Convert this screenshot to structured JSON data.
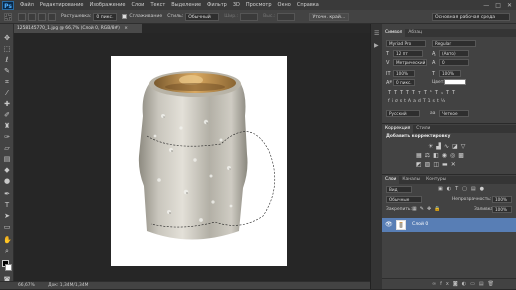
{
  "app": {
    "logo": "Ps"
  },
  "menu": [
    "Файл",
    "Редактирование",
    "Изображение",
    "Слои",
    "Текст",
    "Выделение",
    "Фильтр",
    "3D",
    "Просмотр",
    "Окно",
    "Справка"
  ],
  "window_controls": {
    "minimize": "—",
    "maximize": "□",
    "close": "✕"
  },
  "options": {
    "feather_label": "Растушевка:",
    "feather_value": "0 пикс.",
    "antialias_label": "Сглаживание",
    "style_label": "Стиль:",
    "style_value": "Обычный",
    "width_label": "Шир.:",
    "height_label": "Выс.:",
    "refine_button": "Уточн. край...",
    "workspace": "Основная рабочая среда"
  },
  "document": {
    "tab_title": "1258145770_1.jpg @ 66,7% (Слой 0, RGB/8#)",
    "tab_close": "×"
  },
  "status": {
    "zoom": "66,67%",
    "doc_size": "Док: 1,34М/1,34М"
  },
  "character_panel": {
    "tabs": [
      "Символ",
      "Абзац"
    ],
    "font_family": "Myriad Pro",
    "font_style": "Regular",
    "font_size": "12 пт",
    "leading": "(Авто)",
    "kerning": "Метрический",
    "tracking": "0",
    "scale_v": "100%",
    "scale_h": "100%",
    "baseline": "0 пикс.",
    "color_label": "Цвет:",
    "type_buttons": [
      "T",
      "T",
      "TT",
      "Tт",
      "T¹",
      "T₁",
      "T",
      "T"
    ],
    "extra_buttons": [
      "fi",
      "ơ",
      "st",
      "A",
      "ad",
      "T",
      "1st",
      "½"
    ],
    "language": "Русский",
    "aa_icon": "aa",
    "antialias": "Четкое"
  },
  "adjustments_panel": {
    "tabs": [
      "Коррекция",
      "Стили"
    ],
    "title": "Добавить корректировку"
  },
  "layers_panel": {
    "tabs": [
      "Слои",
      "Каналы",
      "Контуры"
    ],
    "filter_kind": "Вид",
    "blend_mode": "Обычные",
    "opacity_label": "Непрозрачность:",
    "opacity_value": "100%",
    "lock_label": "Закрепить:",
    "fill_label": "Заливка:",
    "fill_value": "100%",
    "layers": [
      {
        "name": "Слой 0",
        "visible": true
      }
    ]
  },
  "colors": {
    "accent": "#587eb5",
    "ps_blue": "#4fb0ff",
    "panel": "#424242"
  }
}
